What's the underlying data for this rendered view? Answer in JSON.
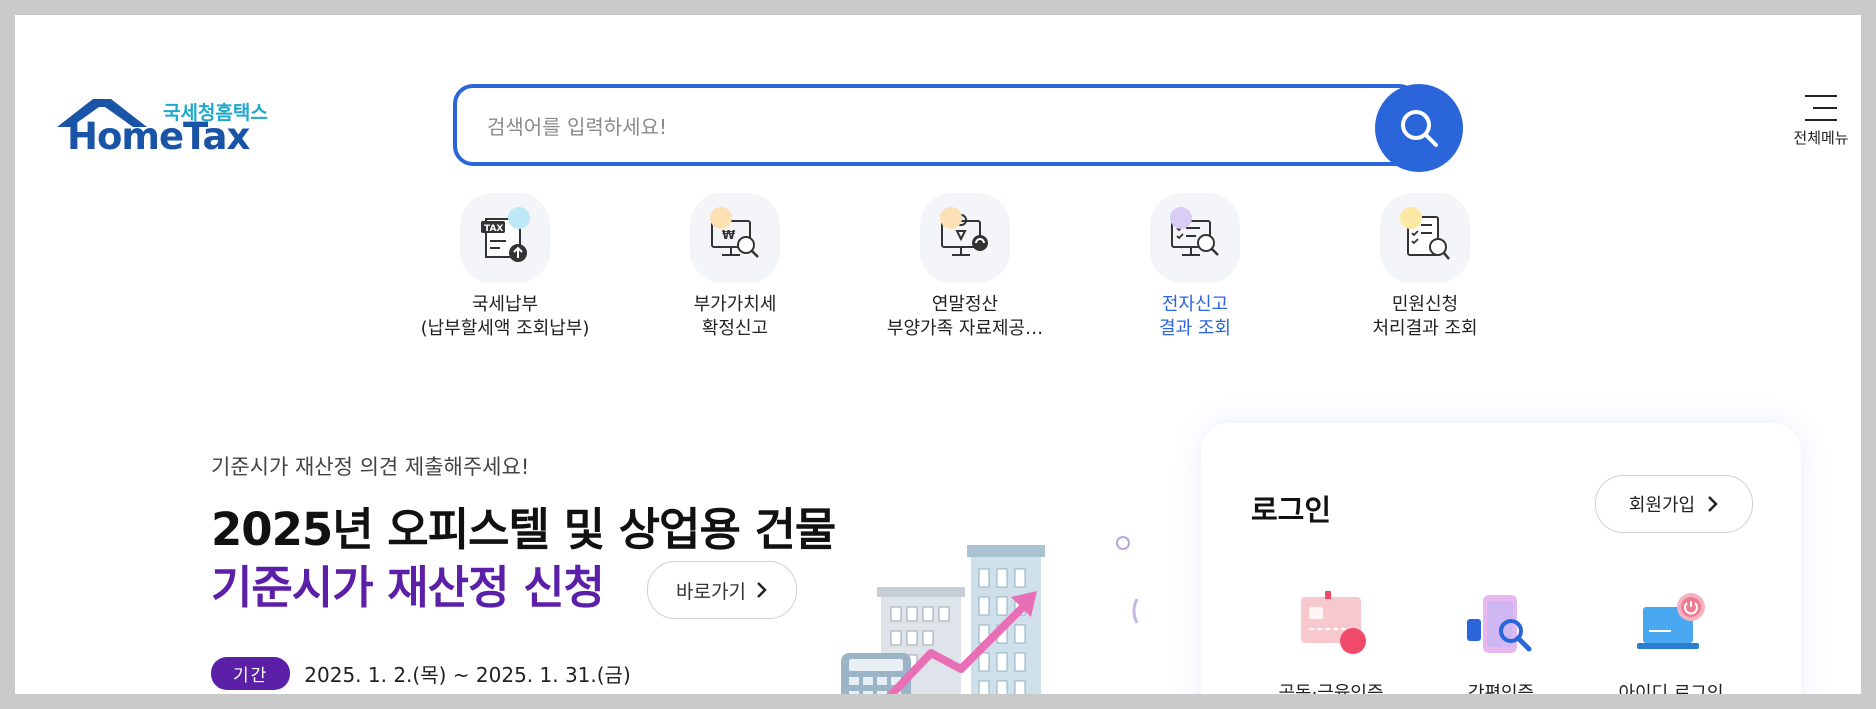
{
  "header": {
    "logo_sub": "국세청홈택스",
    "logo_main": "HomeTax",
    "search_placeholder": "검색어를 입력하세요!",
    "menu_label": "전체메뉴"
  },
  "quick_menu": [
    {
      "line1": "국세납부",
      "line2": "(납부할세액 조회납부)",
      "icon": "tax-payment-icon",
      "dot": "#bde8f7"
    },
    {
      "line1": "부가가치세",
      "line2": "확정신고",
      "icon": "vat-monitor-icon",
      "dot": "#fde0b3"
    },
    {
      "line1": "연말정산",
      "line2": "부양가족 자료제공…",
      "icon": "year-end-settlement-icon",
      "dot": "#fde0b3"
    },
    {
      "line1": "전자신고",
      "line2": "결과 조회",
      "icon": "e-filing-result-icon",
      "dot": "#d9ccf5"
    },
    {
      "line1": "민원신청",
      "line2": "처리결과 조회",
      "icon": "civil-request-icon",
      "dot": "#fde8a6"
    }
  ],
  "banner": {
    "subtitle": "기준시가 재산정 의견 제출해주세요!",
    "title_line1": "2025년 오피스텔 및 상업용 건물",
    "title_line2": "기준시가 재산정 신청",
    "go_label": "바로가기",
    "period_badge": "기간",
    "period_date": "2025. 1. 2.(목) ~ 2025. 1. 31.(금)"
  },
  "login": {
    "title": "로그인",
    "join_label": "회원가입",
    "options": [
      {
        "label": "공동·금융인증",
        "icon": "certificate-icon"
      },
      {
        "label": "간편인증",
        "icon": "simple-auth-icon"
      },
      {
        "label": "아이디 로그인",
        "icon": "id-login-icon"
      }
    ]
  },
  "colors": {
    "accent": "#2a66d9",
    "banner_purple": "#5b1fa8",
    "logo_blue": "#1a54a7"
  }
}
